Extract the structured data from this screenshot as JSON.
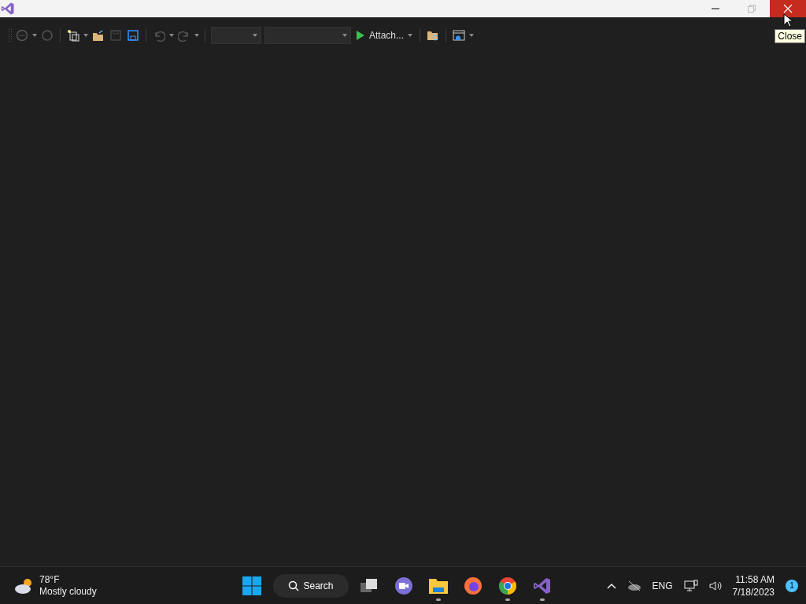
{
  "window": {
    "tooltip": "Close"
  },
  "toolbar": {
    "items": [
      {
        "kind": "web",
        "disabled": true
      },
      {
        "kind": "refresh",
        "disabled": true
      },
      {
        "kind": "new",
        "disabled": false
      },
      {
        "kind": "open",
        "disabled": false
      },
      {
        "kind": "save",
        "disabled": true
      },
      {
        "kind": "saveall",
        "disabled": false
      },
      {
        "kind": "undo",
        "disabled": true
      },
      {
        "kind": "redo",
        "disabled": true
      }
    ],
    "attach": "Attach..."
  },
  "taskbar": {
    "weather": {
      "temp": "78°F",
      "condition": "Mostly cloudy"
    },
    "search": "Search",
    "apps": [
      {
        "kind": "taskview",
        "running": false
      },
      {
        "kind": "meet",
        "running": false
      },
      {
        "kind": "files",
        "running": true
      },
      {
        "kind": "firefox",
        "running": false
      },
      {
        "kind": "chrome",
        "running": true
      },
      {
        "kind": "vs",
        "running": true
      }
    ],
    "language": "ENG",
    "time": "11:58 AM",
    "date": "7/18/2023",
    "notifications": "1"
  }
}
